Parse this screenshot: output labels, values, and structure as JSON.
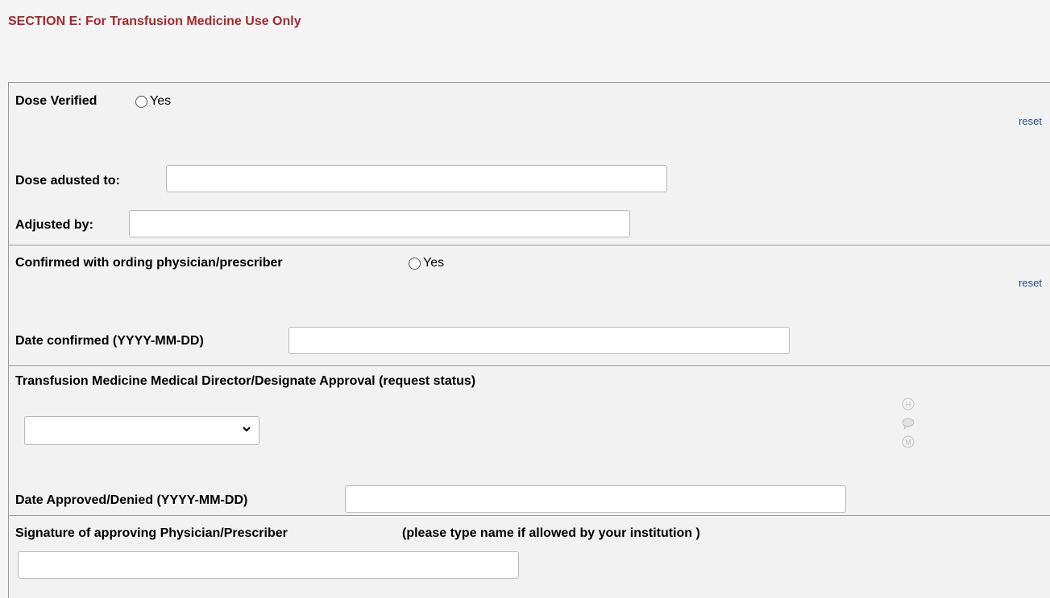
{
  "section_title": "SECTION E: For Transfusion Medicine Use Only",
  "dose_verified": {
    "label": "Dose Verified",
    "option_yes": "Yes",
    "reset": "reset"
  },
  "dose_adjusted": {
    "label": "Dose adusted to:",
    "value": ""
  },
  "adjusted_by": {
    "label": "Adjusted by:",
    "value": ""
  },
  "confirmed_physician": {
    "label": "Confirmed with ording physician/prescriber",
    "option_yes": "Yes",
    "reset": "reset"
  },
  "date_confirmed": {
    "label": "Date confirmed (YYYY-MM-DD)",
    "value": ""
  },
  "approval": {
    "label": "Transfusion Medicine Medical Director/Designate Approval (request status)",
    "selected": "",
    "icons": [
      "history-icon",
      "comment-icon",
      "missing-data-icon"
    ]
  },
  "date_approved": {
    "label": "Date Approved/Denied (YYYY-MM-DD)",
    "value": ""
  },
  "signature": {
    "label": "Signature of approving Physician/Prescriber",
    "note": "(please type name if allowed by your institution )",
    "value": ""
  }
}
